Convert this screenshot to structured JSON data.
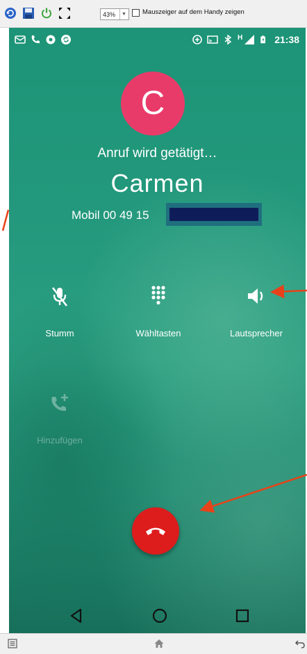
{
  "toolbar": {
    "zoom_value": "43%",
    "mouse_pointer_label": "Mauszeiger auf dem Handy zeigen",
    "icons": [
      "refresh-icon",
      "save-icon",
      "power-icon",
      "fullscreen-icon"
    ]
  },
  "status_bar": {
    "time": "21:38",
    "left_icons": [
      "message-icon",
      "phone-icon",
      "record-icon",
      "sync-icon"
    ],
    "right_icons": [
      "data-saver-icon",
      "cast-icon",
      "bluetooth-icon",
      "signal-icon",
      "battery-icon"
    ],
    "network_label": "H"
  },
  "call": {
    "avatar_letter": "C",
    "status": "Anruf wird getätigt…",
    "name": "Carmen",
    "number": "Mobil 00 49 15"
  },
  "controls": {
    "mute": "Stumm",
    "keypad": "Wähltasten",
    "speaker": "Lautsprecher",
    "add": "Hinzufügen"
  },
  "colors": {
    "avatar": "#e93b6a",
    "end_call": "#dd1c1c",
    "background": "#1d9477",
    "annotation_arrow": "#e8421a",
    "redaction": "#0e1d5a"
  },
  "navigation": [
    "back-icon",
    "home-icon",
    "recents-icon"
  ],
  "host_bottom": [
    "menu-icon",
    "home-icon",
    "back-icon"
  ]
}
